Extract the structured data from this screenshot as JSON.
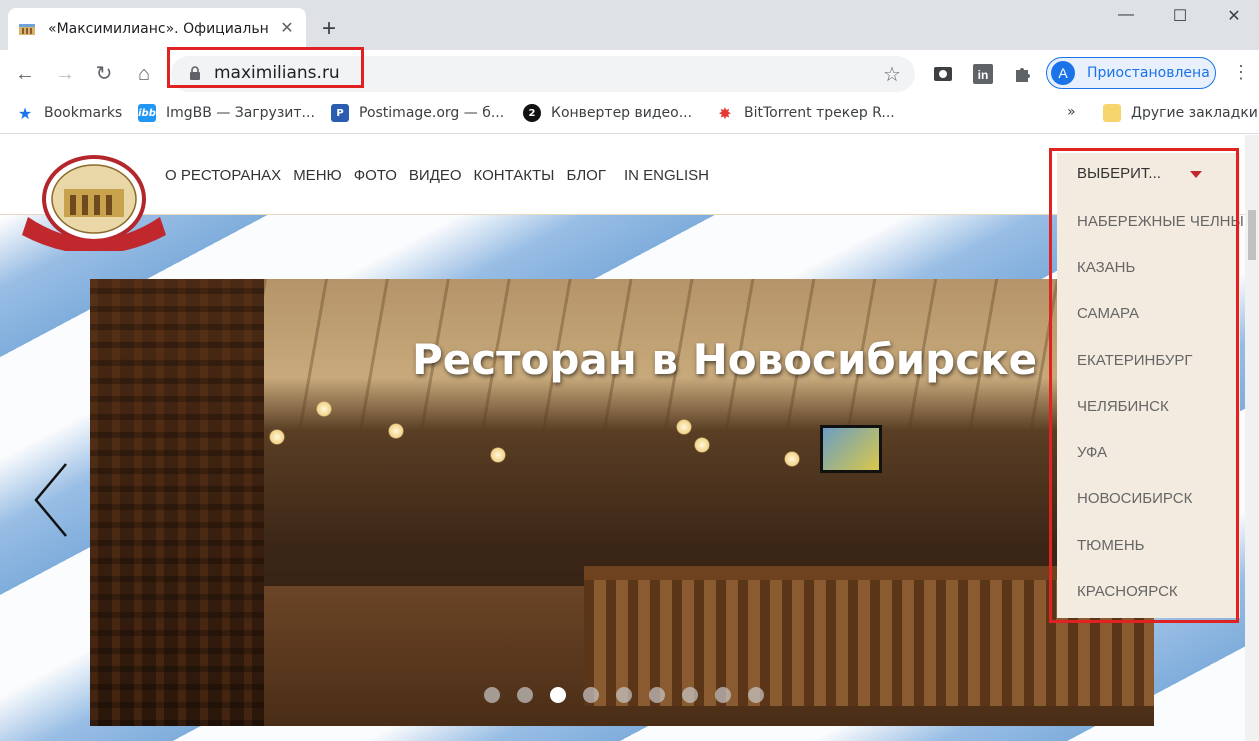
{
  "browser": {
    "tab_title": "«Максимилианс». Официальны",
    "url": "maximilians.ru",
    "profile_initial": "A",
    "profile_label": "Приостановлена",
    "bookmarks": [
      {
        "label": "Bookmarks",
        "icon": "star-icon"
      },
      {
        "label": "ImgBB — Загрузит...",
        "icon": "imgbb-icon"
      },
      {
        "label": "Postimage.org — б...",
        "icon": "postimage-icon"
      },
      {
        "label": "Конвертер видео...",
        "icon": "converter-icon"
      },
      {
        "label": "BitTorrent трекер R...",
        "icon": "torrent-icon"
      }
    ],
    "overflow": "»",
    "other_bookmarks": "Другие закладки"
  },
  "site": {
    "nav": [
      "О РЕСТОРАНАХ",
      "МЕНЮ",
      "ФОТО",
      "ВИДЕО",
      "КОНТАКТЫ",
      "БЛОГ",
      "IN ENGLISH"
    ],
    "slide_title": "Ресторан в Новосибирске",
    "city_select": "ВЫБЕРИТ...",
    "cities": [
      "НАБЕРЕЖНЫЕ ЧЕЛНЫ",
      "КАЗАНЬ",
      "САМАРА",
      "ЕКАТЕРИНБУРГ",
      "ЧЕЛЯБИНСК",
      "УФА",
      "НОВОСИБИРСК",
      "ТЮМЕНЬ",
      "КРАСНОЯРСК"
    ],
    "dots_count": 9,
    "active_dot": 3
  },
  "colors": {
    "highlight": "#e02222",
    "caret": "#c0282d",
    "panel": "#f3ebdf"
  }
}
